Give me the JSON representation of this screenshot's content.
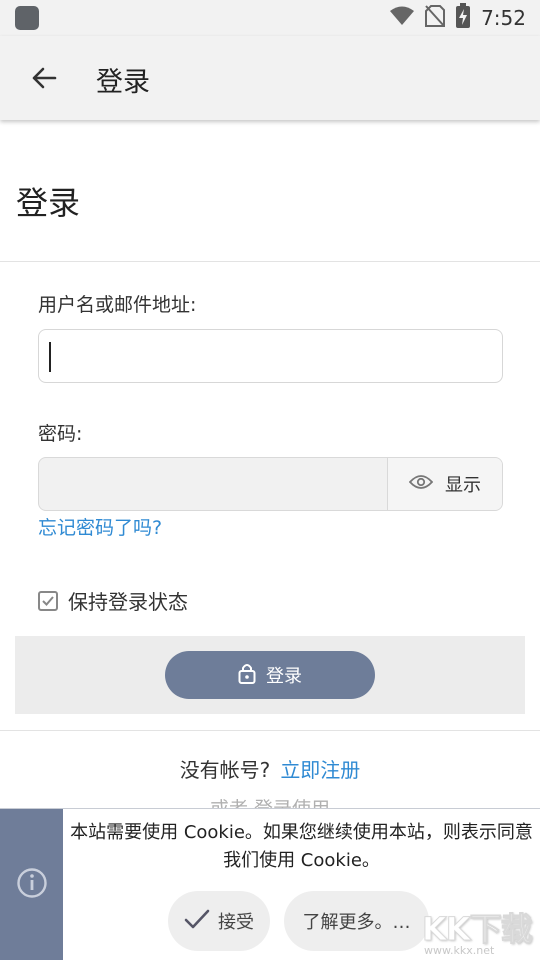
{
  "status_bar": {
    "time": "7:52",
    "icons": [
      "app-icon",
      "wifi-icon",
      "no-sim-icon",
      "battery-charging-icon"
    ]
  },
  "app_bar": {
    "title": "登录",
    "back_icon": "back-arrow-icon"
  },
  "page": {
    "title": "登录"
  },
  "form": {
    "username_label": "用户名或邮件地址:",
    "username_value": "",
    "password_label": "密码:",
    "password_value": "",
    "show_password_label": "显示",
    "forgot_link": "忘记密码了吗?",
    "remember_label": "保持登录状态",
    "remember_checked": true,
    "login_button": "登录"
  },
  "signup": {
    "prompt": "没有帐号?",
    "link": "立即注册"
  },
  "alt_login": "或者 登录使用",
  "cookie_banner": {
    "text": "本站需要使用 Cookie。如果您继续使用本站，则表示同意我们使用 Cookie。",
    "accept_label": "接受",
    "more_label": "了解更多。…"
  },
  "watermark": {
    "text": "KK下载",
    "url": "www.kkx.net"
  },
  "colors": {
    "accent_blue": "#2f8ad3",
    "button_slate": "#6e7d99",
    "app_bar_bg": "#f2f2f2"
  }
}
